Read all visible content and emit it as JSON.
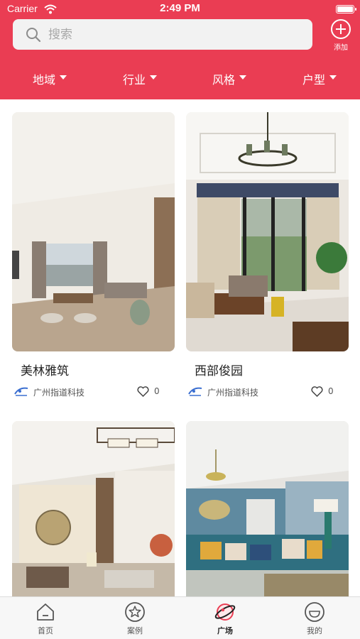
{
  "status_bar": {
    "carrier": "Carrier",
    "time": "2:49 PM"
  },
  "search": {
    "placeholder": "搜索"
  },
  "add_button": {
    "label": "添加"
  },
  "filters": [
    {
      "label": "地域"
    },
    {
      "label": "行业"
    },
    {
      "label": "风格"
    },
    {
      "label": "户型"
    }
  ],
  "cards": [
    {
      "title": "美林雅筑",
      "company": "广州指道科技",
      "likes": "0",
      "image": "living-room-minimal-photo"
    },
    {
      "title": "西部俊园",
      "company": "广州指道科技",
      "likes": "0",
      "image": "living-room-chandelier-photo"
    },
    {
      "title": "",
      "company": "",
      "likes": "",
      "image": "chinese-style-living-room-photo"
    },
    {
      "title": "",
      "company": "",
      "likes": "",
      "image": "blue-sofa-living-room-photo"
    }
  ],
  "tabbar": [
    {
      "label": "首页",
      "icon": "home-icon",
      "active": false
    },
    {
      "label": "案例",
      "icon": "star-icon",
      "active": false
    },
    {
      "label": "广场",
      "icon": "planet-icon",
      "active": true
    },
    {
      "label": "我的",
      "icon": "smiley-icon",
      "active": false
    }
  ],
  "colors": {
    "accent": "#ea3d53",
    "tabbar_bg": "#f7f7f7"
  }
}
